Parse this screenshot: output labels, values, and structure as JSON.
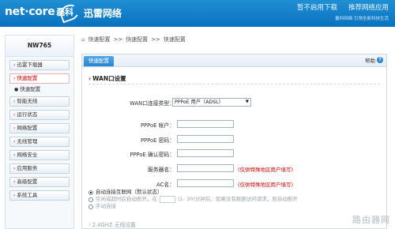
{
  "header": {
    "logo_en": "net·core",
    "logo_cn": "磊科",
    "brand2": "迅雷网络",
    "links": [
      "暂不启用下载",
      "推荐网络应用"
    ],
    "sub": "磊科网络 引领全新科技生活"
  },
  "sidebar": {
    "device": "NW765",
    "items": [
      {
        "label": "迅雷下载器",
        "active": false
      },
      {
        "label": "快速配置",
        "active": true
      },
      {
        "label": "智能无线",
        "active": false
      },
      {
        "label": "运行状态",
        "active": false
      },
      {
        "label": "网络配置",
        "active": false
      },
      {
        "label": "无线管理",
        "active": false
      },
      {
        "label": "网络安全",
        "active": false
      },
      {
        "label": "应用服务",
        "active": false
      },
      {
        "label": "高级配置",
        "active": false
      },
      {
        "label": "系统工具",
        "active": false
      }
    ],
    "sub_item": "快速配置"
  },
  "breadcrumb": {
    "items": [
      "快速配置",
      ">>",
      "快速配置",
      ">>",
      "快速配置"
    ]
  },
  "panel": {
    "tab": "快速配置",
    "help": "帮助",
    "section_title": "WAN口设置",
    "wan_type_label": "WAN口连接类型：",
    "wan_type_value": "PPPoE 用户（ADSL）",
    "pppoe_user_label": "PPPoE 帐户：",
    "pppoe_user_value": "",
    "pppoe_pass_label": "PPPoE 密码：",
    "pppoe_pass_value": "",
    "pppoe_confirm_label": "PPPoE 确认密码：",
    "pppoe_confirm_value": "",
    "server_label": "服务器名：",
    "server_value": "",
    "server_note": "(仅供特殊地区用户填写)",
    "ac_label": "AC名：",
    "ac_value": "",
    "ac_note": "(仅供特殊地区用户填写)",
    "radio1": "自动连接互联网（默认状态）",
    "radio2_a": "空闲或超时后自动断开，在",
    "radio2_b": "(1- 30)分钟后，如果没有数据访问请求，则自动断开",
    "radio3": "手动连接",
    "section2": "2.4GHZ 无线设置"
  },
  "watermark": "路由器网"
}
